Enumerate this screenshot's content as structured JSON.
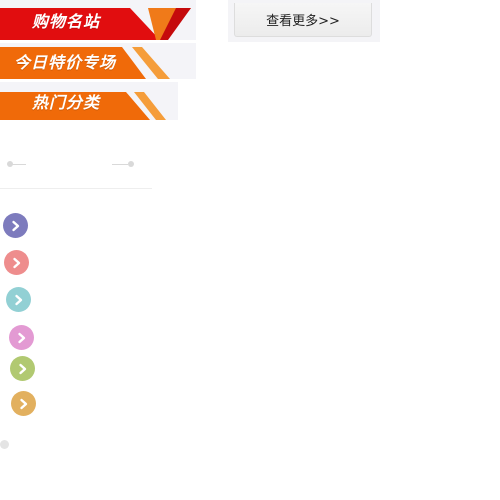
{
  "banners": [
    {
      "label": "购物名站",
      "color": "#e10d0f",
      "accent": "#f07a19"
    },
    {
      "label": "今日特价专场",
      "color": "#f06a09",
      "accent": "#f59d3a"
    },
    {
      "label": "热门分类",
      "color": "#f06a09",
      "accent": "#f59d3a"
    }
  ],
  "more_button": {
    "label": "查看更多>>"
  },
  "arrow_icons": [
    {
      "name": "chevron-right-icon",
      "color": "#7d7bbd"
    },
    {
      "name": "chevron-right-icon",
      "color": "#ee8d8d"
    },
    {
      "name": "chevron-right-icon",
      "color": "#92d0d4"
    },
    {
      "name": "chevron-right-icon",
      "color": "#e39ad3"
    },
    {
      "name": "chevron-right-icon",
      "color": "#b1c971"
    },
    {
      "name": "chevron-right-icon",
      "color": "#e2b05f"
    }
  ]
}
